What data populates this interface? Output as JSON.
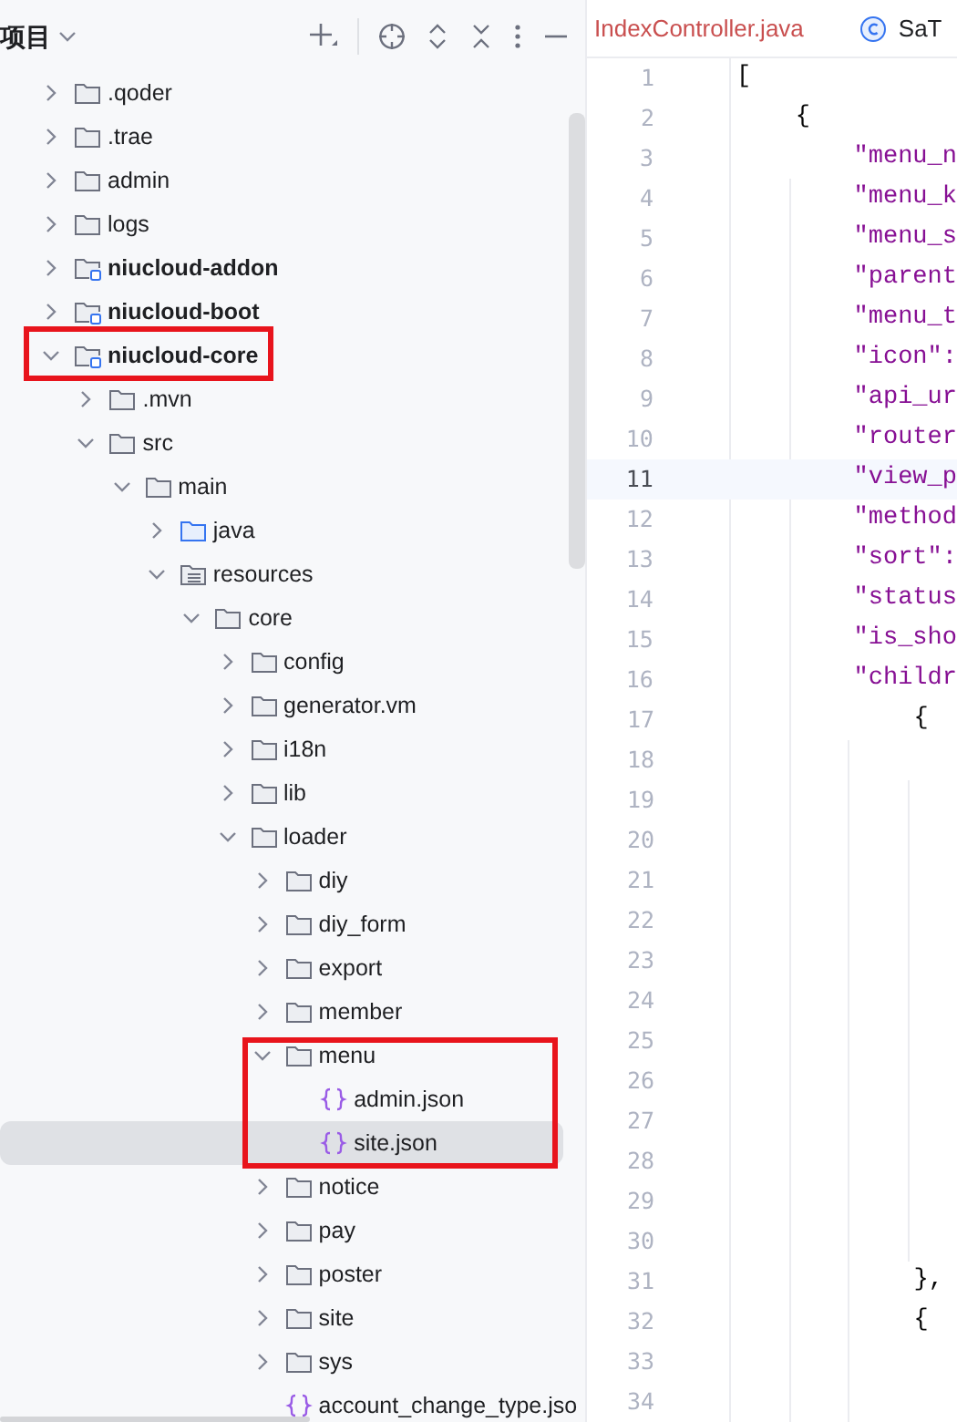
{
  "project_panel": {
    "title": "项目",
    "tree": [
      {
        "label": ".qoder",
        "kind": "folder",
        "expanded": false,
        "selected": false
      },
      {
        "label": ".trae",
        "kind": "folder",
        "expanded": false,
        "selected": false
      },
      {
        "label": "admin",
        "kind": "folder",
        "expanded": false,
        "selected": false
      },
      {
        "label": "logs",
        "kind": "folder",
        "expanded": false,
        "selected": false
      },
      {
        "label": "niucloud-addon",
        "kind": "module",
        "expanded": false,
        "selected": false
      },
      {
        "label": "niucloud-boot",
        "kind": "module",
        "expanded": false,
        "selected": false
      },
      {
        "label": "niucloud-core",
        "kind": "module",
        "expanded": true,
        "selected": false,
        "highlighted": true,
        "children": [
          {
            "label": ".mvn",
            "kind": "folder",
            "expanded": false,
            "selected": false
          },
          {
            "label": "src",
            "kind": "folder",
            "expanded": true,
            "selected": false,
            "children": [
              {
                "label": "main",
                "kind": "folder",
                "expanded": true,
                "selected": false,
                "children": [
                  {
                    "label": "java",
                    "kind": "source_root",
                    "expanded": false,
                    "selected": false
                  },
                  {
                    "label": "resources",
                    "kind": "resource_root",
                    "expanded": true,
                    "selected": false,
                    "children": [
                      {
                        "label": "core",
                        "kind": "folder",
                        "expanded": true,
                        "selected": false,
                        "children": [
                          {
                            "label": "config",
                            "kind": "folder",
                            "expanded": false,
                            "selected": false
                          },
                          {
                            "label": "generator.vm",
                            "kind": "folder",
                            "expanded": false,
                            "selected": false
                          },
                          {
                            "label": "i18n",
                            "kind": "folder",
                            "expanded": false,
                            "selected": false
                          },
                          {
                            "label": "lib",
                            "kind": "folder",
                            "expanded": false,
                            "selected": false
                          },
                          {
                            "label": "loader",
                            "kind": "folder",
                            "expanded": true,
                            "selected": false,
                            "children": [
                              {
                                "label": "diy",
                                "kind": "folder",
                                "expanded": false,
                                "selected": false
                              },
                              {
                                "label": "diy_form",
                                "kind": "folder",
                                "expanded": false,
                                "selected": false
                              },
                              {
                                "label": "export",
                                "kind": "folder",
                                "expanded": false,
                                "selected": false
                              },
                              {
                                "label": "member",
                                "kind": "folder",
                                "expanded": false,
                                "selected": false
                              },
                              {
                                "label": "menu",
                                "kind": "folder",
                                "expanded": true,
                                "selected": false,
                                "highlighted": true,
                                "children": [
                                  {
                                    "label": "admin.json",
                                    "kind": "json",
                                    "selected": false
                                  },
                                  {
                                    "label": "site.json",
                                    "kind": "json",
                                    "selected": true
                                  }
                                ]
                              },
                              {
                                "label": "notice",
                                "kind": "folder",
                                "expanded": false,
                                "selected": false
                              },
                              {
                                "label": "pay",
                                "kind": "folder",
                                "expanded": false,
                                "selected": false
                              },
                              {
                                "label": "poster",
                                "kind": "folder",
                                "expanded": false,
                                "selected": false
                              },
                              {
                                "label": "site",
                                "kind": "folder",
                                "expanded": false,
                                "selected": false
                              },
                              {
                                "label": "sys",
                                "kind": "folder",
                                "expanded": false,
                                "selected": false
                              },
                              {
                                "label": "account_change_type.jso",
                                "kind": "json",
                                "selected": false
                              }
                            ]
                          }
                        ]
                      }
                    ]
                  }
                ]
              }
            ]
          }
        ]
      }
    ]
  },
  "editor": {
    "tabs": [
      {
        "label": "IndexController.java",
        "kind": "plain",
        "has_errors": true
      },
      {
        "label": "SaT",
        "kind": "class",
        "has_errors": false
      }
    ],
    "lines": [
      {
        "number": "1",
        "code": "[",
        "current": false
      },
      {
        "number": "2",
        "code": "    {",
        "current": false
      },
      {
        "number": "3",
        "code": "        \"menu_n",
        "current": false
      },
      {
        "number": "4",
        "code": "        \"menu_k",
        "current": false
      },
      {
        "number": "5",
        "code": "        \"menu_s",
        "current": false
      },
      {
        "number": "6",
        "code": "        \"parent",
        "current": false
      },
      {
        "number": "7",
        "code": "        \"menu_t",
        "current": false
      },
      {
        "number": "8",
        "code": "        \"icon\":",
        "current": false
      },
      {
        "number": "9",
        "code": "        \"api_ur",
        "current": false
      },
      {
        "number": "10",
        "code": "        \"router",
        "current": false
      },
      {
        "number": "11",
        "code": "        \"view_p",
        "current": true
      },
      {
        "number": "12",
        "code": "        \"method",
        "current": false
      },
      {
        "number": "13",
        "code": "        \"sort\":",
        "current": false
      },
      {
        "number": "14",
        "code": "        \"status",
        "current": false
      },
      {
        "number": "15",
        "code": "        \"is_sho",
        "current": false
      },
      {
        "number": "16",
        "code": "        \"childr",
        "current": false
      },
      {
        "number": "17",
        "code": "            {",
        "current": false
      },
      {
        "number": "18",
        "current": false
      },
      {
        "number": "19",
        "current": false
      },
      {
        "number": "20",
        "current": false
      },
      {
        "number": "21",
        "current": false
      },
      {
        "number": "22",
        "current": false
      },
      {
        "number": "23",
        "current": false
      },
      {
        "number": "24",
        "current": false
      },
      {
        "number": "25",
        "current": false
      },
      {
        "number": "26",
        "current": false
      },
      {
        "number": "27",
        "current": false
      },
      {
        "number": "28",
        "current": false
      },
      {
        "number": "29",
        "current": false
      },
      {
        "number": "30",
        "current": false
      },
      {
        "number": "31",
        "code": "            },",
        "current": false
      },
      {
        "number": "32",
        "code": "            {",
        "current": false
      },
      {
        "number": "33",
        "current": false
      },
      {
        "number": "34",
        "current": false
      }
    ]
  }
}
